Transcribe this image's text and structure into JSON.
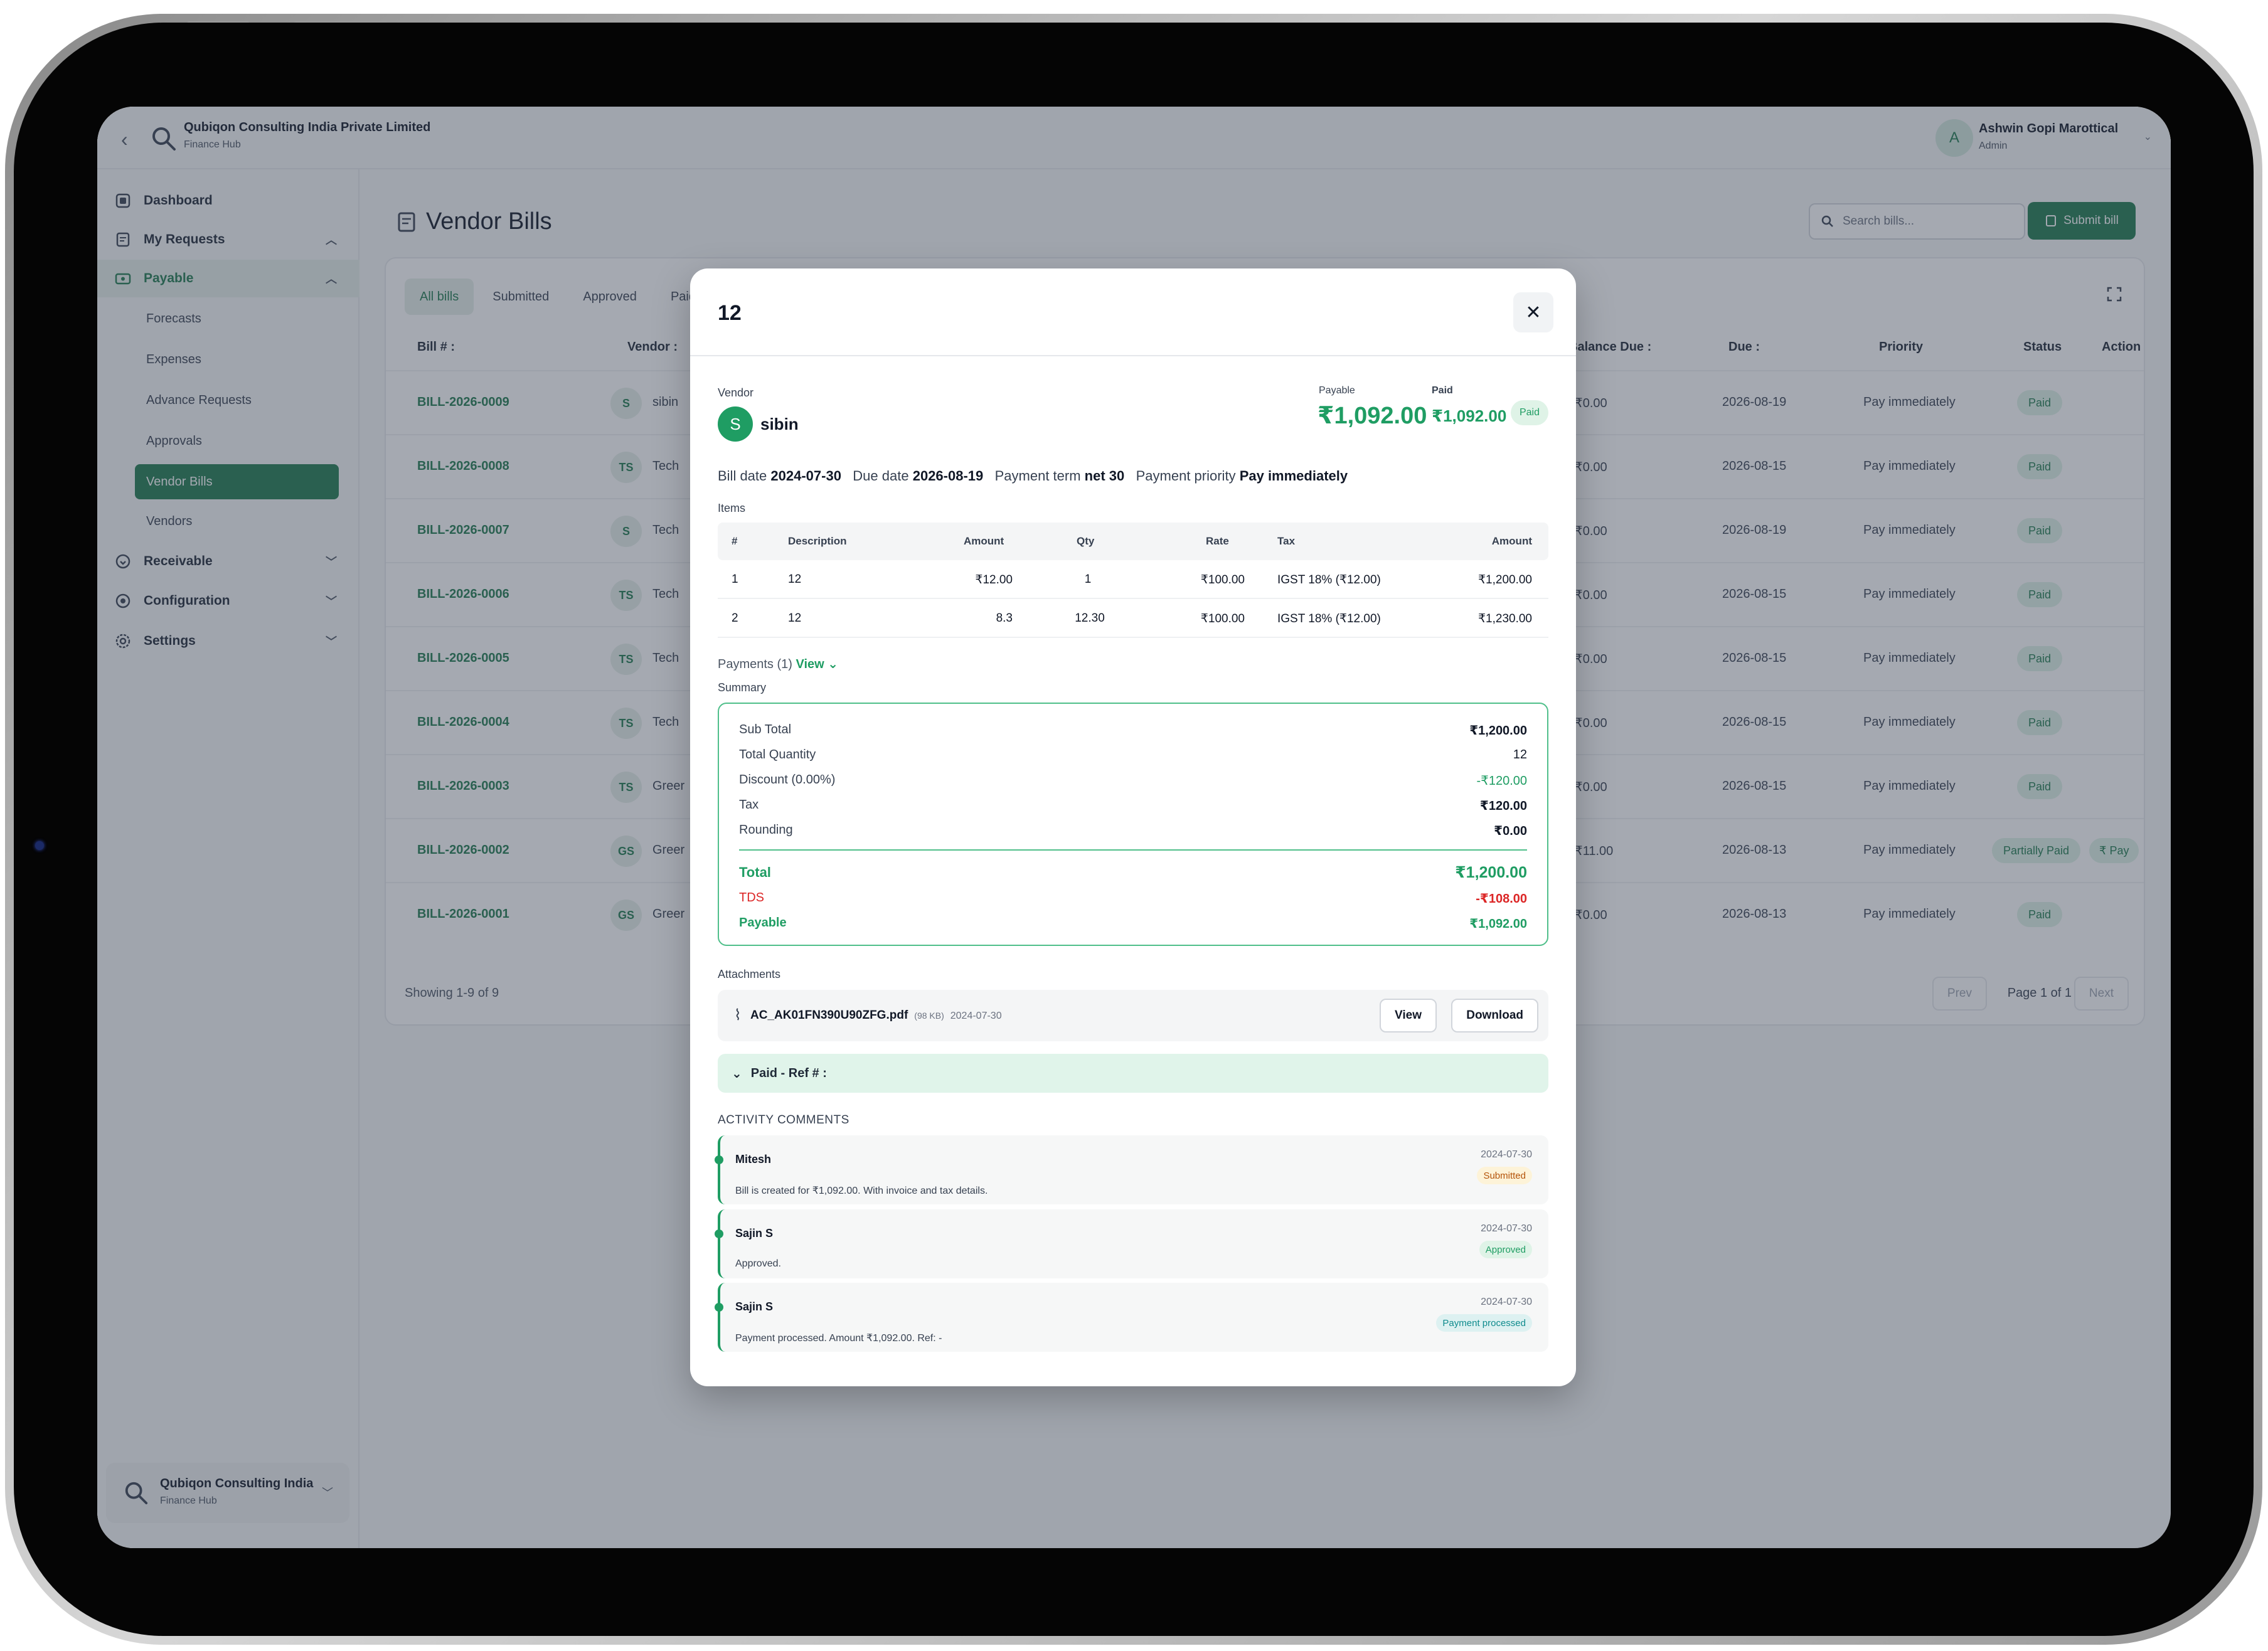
{
  "app": {
    "org_name": "Qubiqon Consulting India Private Limited",
    "org_sub": "Finance Hub",
    "user_initial": "A",
    "user_name": "Ashwin Gopi Marottical",
    "user_role": "Admin"
  },
  "sidebar": {
    "items": [
      {
        "label": "Dashboard",
        "icon": "dashboard-icon"
      },
      {
        "label": "My Requests",
        "icon": "requests-icon"
      },
      {
        "label": "Payable",
        "icon": "payable-icon"
      },
      {
        "label": "Receivable",
        "icon": "receivable-icon"
      },
      {
        "label": "Configuration",
        "icon": "configuration-icon"
      },
      {
        "label": "Settings",
        "icon": "settings-icon"
      }
    ],
    "payable_sub": [
      "Forecasts",
      "Expenses",
      "Advance Requests",
      "Approvals",
      "Vendor Bills",
      "Vendors"
    ],
    "footer_title": "Qubiqon Consulting India",
    "footer_sub": "Finance Hub"
  },
  "page": {
    "title": "Vendor Bills",
    "search_placeholder": "Search bills...",
    "submit_label": "Submit bill",
    "tabs": [
      "All bills",
      "Submitted",
      "Approved",
      "Paid"
    ],
    "headers": {
      "bill": "Bill # :",
      "vendor": "Vendor :",
      "balance": "Balance Due :",
      "due": "Due :",
      "priority": "Priority",
      "status": "Status",
      "action": "Action"
    },
    "rows": [
      {
        "bill": "BILL-2026-0009",
        "av": "S",
        "vendor": "sibin",
        "balance": "₹0.00",
        "due": "2026-08-19",
        "priority": "Pay immediately",
        "status": "Paid",
        "action": ""
      },
      {
        "bill": "BILL-2026-0008",
        "av": "TS",
        "vendor": "Tech",
        "balance": "₹0.00",
        "due": "2026-08-15",
        "priority": "Pay immediately",
        "status": "Paid",
        "action": ""
      },
      {
        "bill": "BILL-2026-0007",
        "av": "S",
        "vendor": "Tech",
        "balance": "₹0.00",
        "due": "2026-08-19",
        "priority": "Pay immediately",
        "status": "Paid",
        "action": ""
      },
      {
        "bill": "BILL-2026-0006",
        "av": "TS",
        "vendor": "Tech",
        "balance": "₹0.00",
        "due": "2026-08-15",
        "priority": "Pay immediately",
        "status": "Paid",
        "action": ""
      },
      {
        "bill": "BILL-2026-0005",
        "av": "TS",
        "vendor": "Tech",
        "balance": "₹0.00",
        "due": "2026-08-15",
        "priority": "Pay immediately",
        "status": "Paid",
        "action": ""
      },
      {
        "bill": "BILL-2026-0004",
        "av": "TS",
        "vendor": "Tech",
        "balance": "₹0.00",
        "due": "2026-08-15",
        "priority": "Pay immediately",
        "status": "Paid",
        "action": ""
      },
      {
        "bill": "BILL-2026-0003",
        "av": "TS",
        "vendor": "Greer",
        "balance": "₹0.00",
        "due": "2026-08-15",
        "priority": "Pay immediately",
        "status": "Paid",
        "action": ""
      },
      {
        "bill": "BILL-2026-0002",
        "av": "GS",
        "vendor": "Greer",
        "balance": "₹11.00",
        "due": "2026-08-13",
        "priority": "Pay immediately",
        "status": "Partially Paid",
        "action": "₹ Pay"
      },
      {
        "bill": "BILL-2026-0001",
        "av": "GS",
        "vendor": "Greer",
        "balance": "₹0.00",
        "due": "2026-08-13",
        "priority": "Pay immediately",
        "status": "Paid",
        "action": ""
      }
    ],
    "showing": "Showing 1-9 of 9",
    "prev": "Prev",
    "page_label": "Page 1 of 1",
    "next": "Next"
  },
  "modal": {
    "title": "12",
    "vendor_label": "Vendor",
    "vendor_initial": "S",
    "vendor_name": "sibin",
    "payable_label": "Payable",
    "payable_amount": "₹1,092.00",
    "paid_label": "Paid",
    "paid_amount": "₹1,092.00",
    "paid_badge": "Paid",
    "bill_date_label": "Bill date",
    "bill_date": "2024-07-30",
    "due_date_label": "Due date",
    "due_date": "2026-08-19",
    "term_label": "Payment term",
    "term": "net 30",
    "priority_label": "Payment priority",
    "priority": "Pay immediately",
    "items_label": "Items",
    "item_headers": [
      "#",
      "Description",
      "Amount",
      "Qty",
      "Rate",
      "Tax",
      "Amount"
    ],
    "items": [
      {
        "n": "1",
        "desc": "12",
        "amount": "₹12.00",
        "qty": "1",
        "rate": "₹100.00",
        "tax": "IGST 18% (₹12.00)",
        "total": "₹1,200.00"
      },
      {
        "n": "2",
        "desc": "12",
        "amount": "8.3",
        "qty": "12.30",
        "rate": "₹100.00",
        "tax": "IGST 18% (₹12.00)",
        "total": "₹1,230.00"
      }
    ],
    "payments_label": "Payments (1)",
    "payments_view": "View",
    "summary_label": "Summary",
    "summary": [
      {
        "label": "Sub Total",
        "value": "₹1,200.00"
      },
      {
        "label": "Total Quantity",
        "value": "12"
      },
      {
        "label": "Discount (0.00%)",
        "value": "-₹120.00"
      },
      {
        "label": "Tax",
        "value": "₹120.00"
      },
      {
        "label": "Rounding",
        "value": "₹0.00"
      }
    ],
    "total_label": "Total",
    "total_value": "₹1,200.00",
    "tds_label": "TDS",
    "tds_value": "-₹108.00",
    "payable_row_label": "Payable",
    "payable_row_value": "₹1,092.00",
    "attachments_label": "Attachments",
    "attachment": {
      "name": "AC_AK01FN390U90ZFG.pdf",
      "size": "(98 KB)",
      "date": "2024-07-30",
      "view": "View",
      "download": "Download"
    },
    "paid_ref": "Paid - Ref # :",
    "activity_title": "ACTIVITY COMMENTS",
    "activity": [
      {
        "name": "Mitesh",
        "date": "2024-07-30",
        "badge": "Submitted",
        "text": "Bill is created for ₹1,092.00. With invoice and tax details."
      },
      {
        "name": "Sajin S",
        "date": "2024-07-30",
        "badge": "Approved",
        "text": "Approved."
      },
      {
        "name": "Sajin S",
        "date": "2024-07-30",
        "badge": "Payment processed",
        "text": "Payment processed. Amount ₹1,092.00. Ref: -"
      }
    ]
  },
  "colors": {
    "brand": "#1f7a4f",
    "accent": "#1f9d63",
    "danger": "#dc2626"
  }
}
